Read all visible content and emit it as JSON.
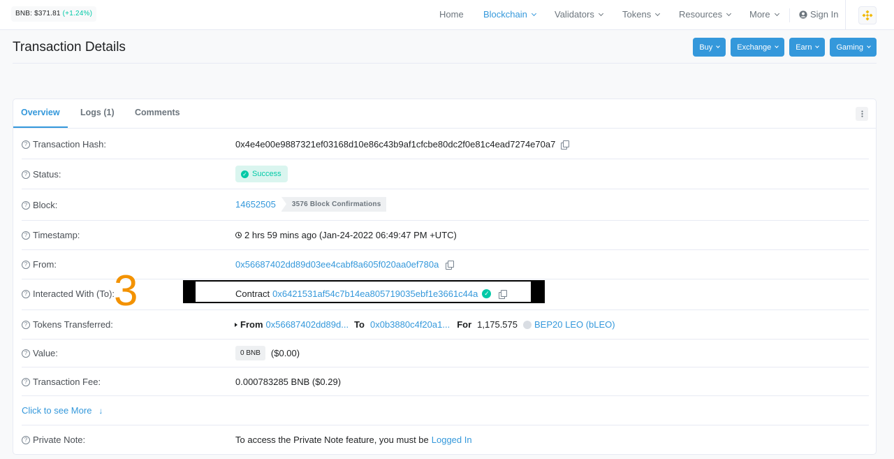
{
  "header": {
    "price_label": "BNB: $371.81",
    "price_change": "(+1.24%)",
    "nav": {
      "home": "Home",
      "blockchain": "Blockchain",
      "validators": "Validators",
      "tokens": "Tokens",
      "resources": "Resources",
      "more": "More",
      "sign_in": "Sign In"
    }
  },
  "page": {
    "title": "Transaction Details",
    "buttons": {
      "buy": "Buy",
      "exchange": "Exchange",
      "earn": "Earn",
      "gaming": "Gaming"
    }
  },
  "tabs": {
    "overview": "Overview",
    "logs": "Logs (1)",
    "comments": "Comments"
  },
  "details": {
    "tx_hash_label": "Transaction Hash:",
    "tx_hash": "0x4e4e00e9887321ef03168d10e86c43b9af1cfcbe80dc2f0e81c4ead7274e70a7",
    "status_label": "Status:",
    "status": "Success",
    "block_label": "Block:",
    "block": "14652505",
    "confirmations": "3576 Block Confirmations",
    "timestamp_label": "Timestamp:",
    "timestamp": "2 hrs 59 mins ago (Jan-24-2022 06:49:47 PM +UTC)",
    "from_label": "From:",
    "from": "0x56687402dd89d03ee4cabf8a605f020aa0ef780a",
    "interacted_label": "Interacted With (To):",
    "contract_prefix": "Contract",
    "contract": "0x6421531af54c7b14ea805719035ebf1e3661c44a",
    "tokens_label": "Tokens Transferred:",
    "tt_from_label": "From",
    "tt_from": "0x56687402dd89d...",
    "tt_to_label": "To",
    "tt_to": "0x0b3880c4f20a1...",
    "tt_for_label": "For",
    "tt_amount": "1,175.575",
    "tt_token": "BEP20 LEO (bLEO)",
    "value_label": "Value:",
    "value_badge": "0 BNB",
    "value_usd": "($0.00)",
    "fee_label": "Transaction Fee:",
    "fee": "0.000783285 BNB ($0.29)",
    "see_more": "Click to see More",
    "note_label": "Private Note:",
    "note_text": "To access the Private Note feature, you must be",
    "note_link": "Logged In"
  },
  "annotation": {
    "number": "3"
  },
  "colors": {
    "accent": "#3498db",
    "success": "#00c9a7",
    "annotation": "#f39200"
  }
}
